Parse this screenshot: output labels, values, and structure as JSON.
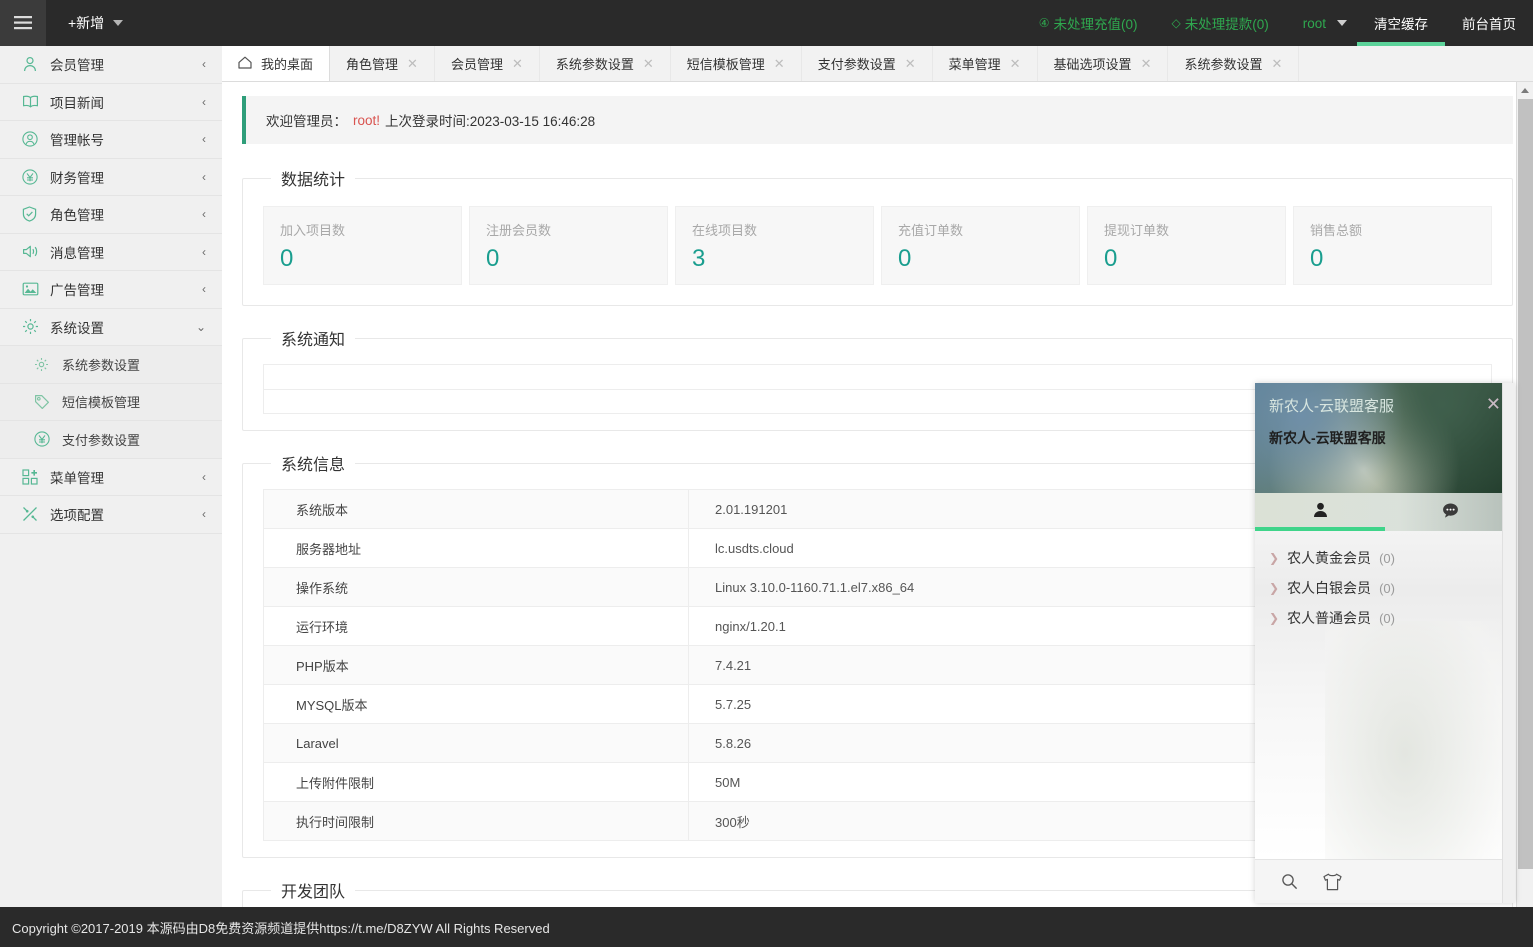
{
  "header": {
    "menu_toggle_icon": "hamburger-icon",
    "add_new_label": "+新增",
    "pending_recharge_label": "未处理充值(0)",
    "pending_recharge_icon": "yen-circle-icon",
    "pending_withdraw_label": "未处理提款(0)",
    "pending_withdraw_icon": "diamond-icon",
    "user_label": "root",
    "clear_cache_label": "清空缓存",
    "front_page_label": "前台首页"
  },
  "sidebar": {
    "items": [
      {
        "label": "会员管理",
        "icon": "user-icon",
        "arrow": "‹",
        "sub": false
      },
      {
        "label": "项目新闻",
        "icon": "book-icon",
        "arrow": "‹",
        "sub": false
      },
      {
        "label": "管理帐号",
        "icon": "user-circle-icon",
        "arrow": "‹",
        "sub": false
      },
      {
        "label": "财务管理",
        "icon": "yen-circle-icon",
        "arrow": "‹",
        "sub": false
      },
      {
        "label": "角色管理",
        "icon": "shield-check-icon",
        "arrow": "‹",
        "sub": false
      },
      {
        "label": "消息管理",
        "icon": "speaker-icon",
        "arrow": "‹",
        "sub": false
      },
      {
        "label": "广告管理",
        "icon": "image-icon",
        "arrow": "‹",
        "sub": false
      },
      {
        "label": "系统设置",
        "icon": "gear-icon",
        "arrow": "⌄",
        "sub": false
      },
      {
        "label": "系统参数设置",
        "icon": "gear-small-icon",
        "arrow": "",
        "sub": true
      },
      {
        "label": "短信模板管理",
        "icon": "tag-icon",
        "arrow": "",
        "sub": true
      },
      {
        "label": "支付参数设置",
        "icon": "yen-circle-icon",
        "arrow": "",
        "sub": true
      },
      {
        "label": "菜单管理",
        "icon": "grid-icon",
        "arrow": "‹",
        "sub": false
      },
      {
        "label": "选项配置",
        "icon": "sliders-icon",
        "arrow": "‹",
        "sub": false
      }
    ]
  },
  "tabs": [
    {
      "label": "我的桌面",
      "active": true,
      "closable": false,
      "icon": "home-icon"
    },
    {
      "label": "角色管理",
      "active": false,
      "closable": true
    },
    {
      "label": "会员管理",
      "active": false,
      "closable": true
    },
    {
      "label": "系统参数设置",
      "active": false,
      "closable": true
    },
    {
      "label": "短信模板管理",
      "active": false,
      "closable": true
    },
    {
      "label": "支付参数设置",
      "active": false,
      "closable": true
    },
    {
      "label": "菜单管理",
      "active": false,
      "closable": true
    },
    {
      "label": "基础选项设置",
      "active": false,
      "closable": true
    },
    {
      "label": "系统参数设置",
      "active": false,
      "closable": true
    }
  ],
  "welcome": {
    "prefix": "欢迎管理员：",
    "username": "root!",
    "last_login": "上次登录时间:2023-03-15 16:46:28"
  },
  "stats": {
    "title": "数据统计",
    "cards": [
      {
        "label": "加入项目数",
        "value": "0"
      },
      {
        "label": "注册会员数",
        "value": "0"
      },
      {
        "label": "在线项目数",
        "value": "3"
      },
      {
        "label": "充值订单数",
        "value": "0"
      },
      {
        "label": "提现订单数",
        "value": "0"
      },
      {
        "label": "销售总额",
        "value": "0"
      }
    ]
  },
  "notice": {
    "title": "系统通知",
    "rows": [
      "",
      ""
    ]
  },
  "sysinfo": {
    "title": "系统信息",
    "rows": [
      {
        "key": "系统版本",
        "value": "2.01.191201"
      },
      {
        "key": "服务器地址",
        "value": "lc.usdts.cloud"
      },
      {
        "key": "操作系统",
        "value": "Linux 3.10.0-1160.71.1.el7.x86_64"
      },
      {
        "key": "运行环境",
        "value": "nginx/1.20.1"
      },
      {
        "key": "PHP版本",
        "value": "7.4.21"
      },
      {
        "key": "MYSQL版本",
        "value": "5.7.25"
      },
      {
        "key": "Laravel",
        "value": "5.8.26"
      },
      {
        "key": "上传附件限制",
        "value": "50M"
      },
      {
        "key": "执行时间限制",
        "value": "300秒"
      }
    ]
  },
  "team": {
    "title": "开发团队"
  },
  "footer": {
    "text": "Copyright ©2017-2019 本源码由D8免费资源频道提供https://t.me/D8ZYW All Rights Reserved"
  },
  "chat": {
    "title_faded": "新农人-云联盟客服",
    "title_main": "新农人-云联盟客服",
    "close_icon": "close-icon",
    "tabs": [
      {
        "icon": "contacts-person-icon",
        "active": true
      },
      {
        "icon": "chat-bubble-icon",
        "active": false
      }
    ],
    "groups": [
      {
        "label": "农人黄金会员",
        "count": "(0)"
      },
      {
        "label": "农人白银会员",
        "count": "(0)"
      },
      {
        "label": "农人普通会员",
        "count": "(0)"
      }
    ],
    "footer_icons": [
      {
        "name": "search-icon"
      },
      {
        "name": "tshirt-icon"
      }
    ]
  },
  "colors": {
    "accent_green": "#5cd39a",
    "stat_value": "#1a9e8f",
    "topbar_bg": "#2a2a2a",
    "sidebar_bg": "#f0f0f0",
    "username_red": "#d9534f"
  }
}
